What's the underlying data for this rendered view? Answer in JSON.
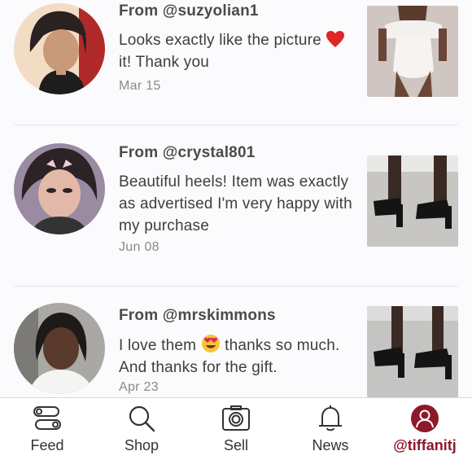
{
  "reviews": [
    {
      "from": "From @suzyolian1",
      "text_before": "Looks exactly like the picture ",
      "emoji": "red-heart",
      "text_after": " it! Thank you",
      "date": "Mar 15"
    },
    {
      "from": "From @crystal801",
      "text": "Beautiful heels! Item was exactly as advertised I'm very happy with my purchase",
      "date": "Jun 08"
    },
    {
      "from": "From @mrskimmons",
      "text_before": "I love them ",
      "emoji": "heart-eyes",
      "text_after": " thanks so much. And thanks for the gift.",
      "date": "Apr 23"
    }
  ],
  "nav": {
    "items": [
      {
        "label": "Feed",
        "icon": "feed-icon"
      },
      {
        "label": "Shop",
        "icon": "search-icon"
      },
      {
        "label": "Sell",
        "icon": "camera-icon"
      },
      {
        "label": "News",
        "icon": "bell-icon"
      },
      {
        "label": "@tiffanitj",
        "icon": "profile-icon",
        "active": true
      }
    ]
  },
  "colors": {
    "accent": "#8c1a2b",
    "background": "#fbfafc",
    "divider": "#e6e4e8"
  }
}
